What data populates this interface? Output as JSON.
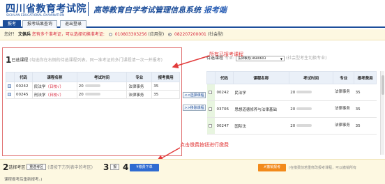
{
  "header": {
    "logo_cn": "四川省教育考试院",
    "logo_en": "SICHUAN EDUCATIONAL EXAMINATION",
    "title_part1": "高等教育自学考试管理信息系统",
    "title_part2": "报考端"
  },
  "nav": {
    "tabs": [
      {
        "label": "报考"
      },
      {
        "label": "报考结果查询"
      },
      {
        "label": "退出登录"
      }
    ]
  },
  "welcome": {
    "greeting": "您好！",
    "name": "文佩兵",
    "warning": "您有多个准考证，可以选择切换准考证:",
    "option1_code": "010803303256",
    "option1_type": "(应用型)",
    "option2_code": "082207200001",
    "option2_type": "(社会型)"
  },
  "left": {
    "step_num": "1",
    "step_label": "已选课程",
    "hint": "(勾选你在右侧的待选课程列表，同一准考证的多门课程请一次一并报考)",
    "columns": [
      "代码",
      "课程名称",
      "考试时间",
      "专业",
      "报考费用"
    ],
    "rows": [
      {
        "code": "00242",
        "name": "民法学",
        "tag": "（日校√）",
        "time": "20",
        "major": "法律事务",
        "fee": "35"
      },
      {
        "code": "00245",
        "name": "刑法学",
        "tag": "（日校√）",
        "time": "20",
        "major": "法律事务",
        "fee": "35"
      }
    ]
  },
  "middle": {
    "select_btn": "<<选择课程",
    "remove_btn": ">>移除课程"
  },
  "right": {
    "step_num": "",
    "label1": "待选课程",
    "label2": "专业:",
    "major_select": "法律事务(H680603",
    "switch_hint": "(社会型考生切换专业)",
    "columns": [
      "代码",
      "课程名称",
      "考试时间",
      "专业",
      "报考费用"
    ],
    "rows": [
      {
        "code": "00242",
        "name": "民法学",
        "time": "20",
        "major": "法律事务",
        "fee": "35"
      },
      {
        "code": "03706",
        "name": "思想道德修养与法律基础",
        "time": "20",
        "major": "法律事务",
        "fee": "35"
      },
      {
        "code": "00247",
        "name": "国际法",
        "time": "20",
        "major": "法律事务",
        "fee": "35"
      }
    ]
  },
  "annotations": {
    "all_courses": "所有已报考课程",
    "pay_hint": "点击缴费按钮进行缴费"
  },
  "bottom": {
    "step2_num": "2",
    "step2_label": "选择考区",
    "reselect_btn": "重选考区",
    "step2_hint": "(请按下方列表中的考区)",
    "step3_num": "3",
    "step3_btn": "报",
    "step4_num": "4",
    "pay_btn": "¥缴费下单",
    "orange_btn": "✗撤销报考",
    "after_hint": "(在缴费前若重修改报考课程，可以撤销所有",
    "note": "课程报考后重新报考。)"
  },
  "colors": {
    "brand": "#1d4e9a",
    "annotation": "#e23b3b",
    "pay": "#2f6bd1",
    "revoke": "#f28a1b"
  }
}
